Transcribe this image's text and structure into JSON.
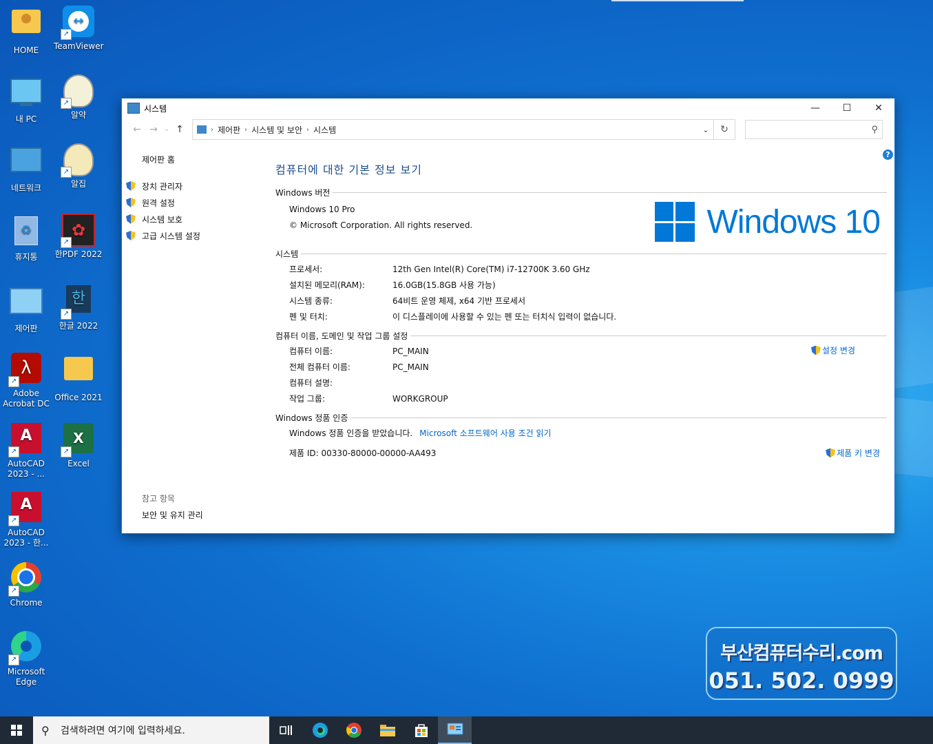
{
  "desktop": {
    "icons": [
      {
        "label": "HOME"
      },
      {
        "label": "TeamViewer"
      },
      {
        "label": "내 PC"
      },
      {
        "label": "알약"
      },
      {
        "label": "네트워크"
      },
      {
        "label": "알집"
      },
      {
        "label": "휴지통"
      },
      {
        "label": "한PDF 2022"
      },
      {
        "label": "제어판"
      },
      {
        "label": "한글 2022"
      },
      {
        "label": "Adobe Acrobat DC"
      },
      {
        "label": "Office 2021"
      },
      {
        "label": "AutoCAD 2023 - ..."
      },
      {
        "label": "Excel"
      },
      {
        "label": "AutoCAD 2023 - 한..."
      },
      {
        "label": "Chrome"
      },
      {
        "label": "Microsoft Edge"
      }
    ],
    "banner": {
      "line1": "부산컴퓨터수리.com",
      "line2": "051. 502. 0999"
    }
  },
  "window": {
    "title": "시스템",
    "breadcrumb": [
      "제어판",
      "시스템 및 보안",
      "시스템"
    ],
    "left": {
      "home": "제어판 홈",
      "links": [
        "장치 관리자",
        "원격 설정",
        "시스템 보호",
        "고급 시스템 설정"
      ],
      "ref_title": "참고 항목",
      "ref_link": "보안 및 유지 관리"
    },
    "main": {
      "heading": "컴퓨터에 대한 기본 정보 보기",
      "edition_title": "Windows 버전",
      "edition": "Windows 10 Pro",
      "copyright": "© Microsoft Corporation. All rights reserved.",
      "logo_text": "Windows 10",
      "system_title": "시스템",
      "system_rows": [
        {
          "k": "프로세서:",
          "v": "12th Gen Intel(R) Core(TM) i7-12700K   3.60 GHz"
        },
        {
          "k": "설치된 메모리(RAM):",
          "v": "16.0GB(15.8GB 사용 가능)"
        },
        {
          "k": "시스템 종류:",
          "v": "64비트 운영 체제, x64 기반 프로세서"
        },
        {
          "k": "펜 및 터치:",
          "v": "이 디스플레이에 사용할 수 있는 펜 또는 터치식 입력이 없습니다."
        }
      ],
      "name_title": "컴퓨터 이름, 도메인 및 작업 그룹 설정",
      "name_rows": [
        {
          "k": "컴퓨터 이름:",
          "v": "PC_MAIN"
        },
        {
          "k": "전체 컴퓨터 이름:",
          "v": "PC_MAIN"
        },
        {
          "k": "컴퓨터 설명:",
          "v": ""
        },
        {
          "k": "작업 그룹:",
          "v": "WORKGROUP"
        }
      ],
      "change_settings": "설정 변경",
      "activation_title": "Windows 정품 인증",
      "activation_status": "Windows 정품 인증을 받았습니다.",
      "license_link": "Microsoft 소프트웨어 사용 조건 읽기",
      "product_id": "제품 ID: 00330-80000-00000-AA493",
      "change_key": "제품 키 변경"
    }
  },
  "taskbar": {
    "search_placeholder": "검색하려면 여기에 입력하세요."
  }
}
